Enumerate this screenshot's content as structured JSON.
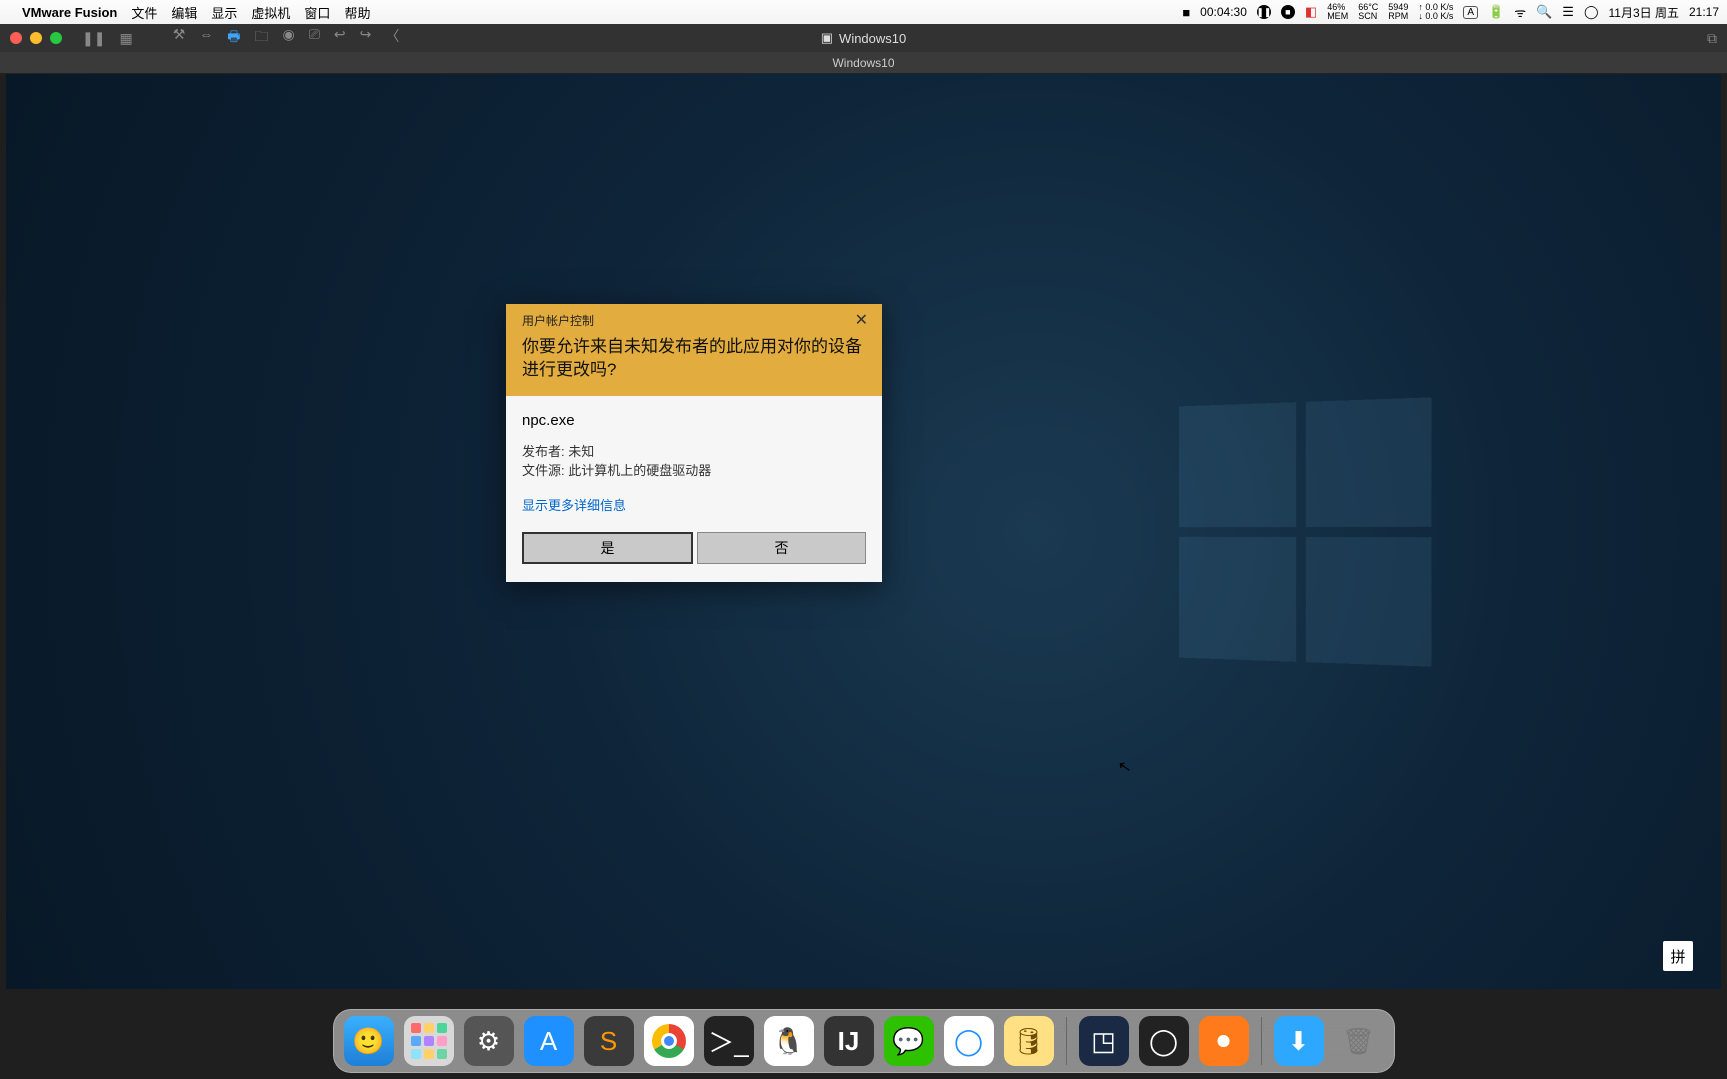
{
  "menubar": {
    "app_name": "VMware Fusion",
    "items": [
      "文件",
      "编辑",
      "显示",
      "虚拟机",
      "窗口",
      "帮助"
    ],
    "recording_time": "00:04:30",
    "mem_pct": "46%",
    "mem_label": "MEM",
    "temp": "66°C",
    "temp_label": "SCN",
    "rpm": "5949",
    "rpm_label": "RPM",
    "net_up": "0.0 K/s",
    "net_down": "0.0 K/s",
    "input_indicator": "A",
    "date": "11月3日 周五",
    "time": "21:17"
  },
  "vm_chrome": {
    "title": "Windows10",
    "sub_title": "Windows10"
  },
  "windows": {
    "ime_badge": "拼"
  },
  "uac": {
    "titlebar": "用户帐户控制",
    "question": "你要允许来自未知发布者的此应用对你的设备进行更改吗?",
    "program": "npc.exe",
    "publisher_line": "发布者: 未知",
    "source_line": "文件源: 此计算机上的硬盘驱动器",
    "details_link": "显示更多详细信息",
    "yes": "是",
    "no": "否"
  },
  "dock": {
    "apps": [
      "finder",
      "launchpad",
      "settings",
      "appstore",
      "sublime",
      "chrome",
      "terminal",
      "qq",
      "idea",
      "wechat",
      "circle",
      "db"
    ],
    "apps_right": [
      "vm",
      "obs",
      "rec"
    ],
    "apps_far": [
      "dl",
      "trash"
    ]
  }
}
